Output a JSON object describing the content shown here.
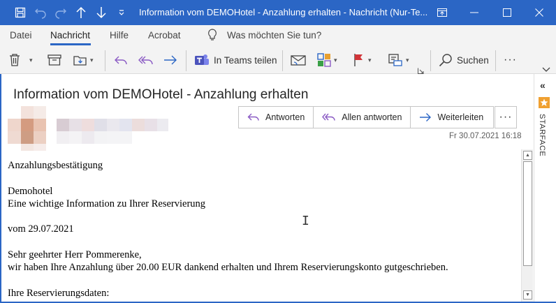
{
  "window": {
    "title": "Information vom DEMOHotel - Anzahlung erhalten  -  Nachricht (Nur-Te...",
    "accent": "#2b66c5"
  },
  "menu": {
    "items": [
      "Datei",
      "Nachricht",
      "Hilfe",
      "Acrobat"
    ],
    "active": "Nachricht",
    "tell_me": "Was möchten Sie tun?"
  },
  "ribbon": {
    "teams_label": "In Teams teilen",
    "search_label": "Suchen",
    "more_label": "···"
  },
  "message": {
    "subject": "Information vom DEMOHotel - Anzahlung erhalten",
    "date": "Fr 30.07.2021 16:18",
    "reply_label": "Antworten",
    "reply_all_label": "Allen antworten",
    "forward_label": "Weiterleiten",
    "more_label": "···",
    "body": {
      "line1": "Anzahlungsbestätigung",
      "line2": "Demohotel",
      "line3": "Eine wichtige Information zu Ihrer Reservierung",
      "line4": "vom 29.07.2021",
      "line5": "Sehr geehrter Herr Pommerenke,",
      "line6": "wir haben Ihre Anzahlung über 20.00 EUR dankend erhalten und Ihrem Reservierungskonto gutgeschrieben.",
      "line7": "Ihre Reservierungsdaten:"
    }
  },
  "side_panel": {
    "label": "STARFACE",
    "accent": "#f0a030"
  }
}
